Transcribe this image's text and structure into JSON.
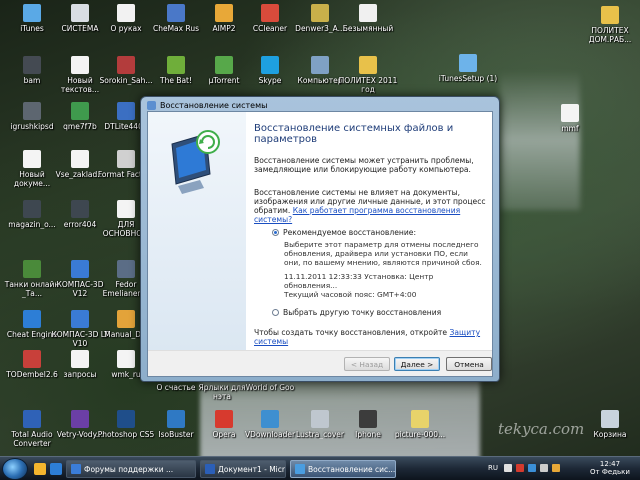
{
  "desktop": {
    "icons": [
      {
        "label": "iTunes",
        "color": "#5aa9e6",
        "col": 0,
        "row": 0
      },
      {
        "label": "СИСТЕМА",
        "color": "#d8dde3",
        "col": 1,
        "row": 0
      },
      {
        "label": "О руках",
        "color": "#f2f2f2",
        "col": 2,
        "row": 0
      },
      {
        "label": "CheMax Rus",
        "color": "#4a78c8",
        "col": 3,
        "row": 0
      },
      {
        "label": "AIMP2",
        "color": "#e8a838",
        "col": 4,
        "row": 0
      },
      {
        "label": "CCleaner",
        "color": "#d94b3b",
        "col": 5,
        "row": 0
      },
      {
        "label": "Denwer3_A...",
        "color": "#c9b04a",
        "col": 6,
        "row": 0
      },
      {
        "label": "Безымянный",
        "color": "#f0f0f0",
        "col": 7,
        "row": 0
      },
      {
        "label": "bam",
        "color": "#444a52",
        "col": 0,
        "row": 1
      },
      {
        "label": "Новый текстов...",
        "color": "#f4f4f4",
        "col": 1,
        "row": 1
      },
      {
        "label": "Sorokin_Sah...",
        "color": "#b33c3c",
        "col": 2,
        "row": 1
      },
      {
        "label": "The Bat!",
        "color": "#6fae3a",
        "col": 3,
        "row": 1
      },
      {
        "label": "µTorrent",
        "color": "#57a84a",
        "col": 4,
        "row": 1
      },
      {
        "label": "Skype",
        "color": "#1ea0e0",
        "col": 5,
        "row": 1
      },
      {
        "label": "Компьютер",
        "color": "#7fa1c4",
        "col": 6,
        "row": 1
      },
      {
        "label": "ПОЛИТЕХ 2011 год",
        "color": "#e8c14a",
        "col": 7,
        "row": 1
      },
      {
        "label": "igrushkipsd",
        "color": "#5d6670",
        "col": 0,
        "row": 2
      },
      {
        "label": "qme7f7b",
        "color": "#3f9a4d",
        "col": 1,
        "row": 2
      },
      {
        "label": "DTLite4402",
        "color": "#3b6fc2",
        "col": 2,
        "row": 2
      },
      {
        "label": "Новый докуме...",
        "color": "#f4f4f4",
        "col": 0,
        "row": 3
      },
      {
        "label": "Vse_zaklad...",
        "color": "#f4f4f4",
        "col": 1,
        "row": 3
      },
      {
        "label": "Format Factory",
        "color": "#d0d0d0",
        "col": 2,
        "row": 3
      },
      {
        "label": "magazin_o...",
        "color": "#3e4750",
        "col": 0,
        "row": 4
      },
      {
        "label": "error404",
        "color": "#3e4750",
        "col": 1,
        "row": 4
      },
      {
        "label": "ДЛЯ ОСНОВНО...",
        "color": "#f4f4f4",
        "col": 2,
        "row": 4
      },
      {
        "label": "Танки онлайн _Та...",
        "color": "#4a8a3a",
        "col": 0,
        "row": 5
      },
      {
        "label": "КОМПАС-3D V12",
        "color": "#3a7bd5",
        "col": 1,
        "row": 5
      },
      {
        "label": "Fedor Emelianen...",
        "color": "#5b6d86",
        "col": 2,
        "row": 5
      },
      {
        "label": "Cheat Engine",
        "color": "#2d7ed6",
        "col": 0,
        "row": 6
      },
      {
        "label": "КОМПАС-3D LT V10",
        "color": "#3a7bd5",
        "col": 1,
        "row": 6
      },
      {
        "label": "Manual_DIP",
        "color": "#e3a33a",
        "col": 2,
        "row": 6
      },
      {
        "label": "TODembel2.6",
        "color": "#c8403a",
        "col": 0,
        "row": 7
      },
      {
        "label": "запросы",
        "color": "#f4f4f4",
        "col": 1,
        "row": 7
      },
      {
        "label": "wmk_ru",
        "color": "#f4f4f4",
        "col": 2,
        "row": 7
      },
      {
        "label": "Total Audio Converter",
        "color": "#2f62b7",
        "col": 0,
        "row": 8
      },
      {
        "label": "Vetry-Vody...",
        "color": "#6b3fa6",
        "col": 1,
        "row": 8
      },
      {
        "label": "Photoshop CS5",
        "color": "#1f4e8a",
        "col": 2,
        "row": 8
      },
      {
        "label": "IsoBuster",
        "color": "#2f79c4",
        "col": 3,
        "row": 8
      },
      {
        "label": "Opera",
        "color": "#d73a2e",
        "col": 4,
        "row": 8
      },
      {
        "label": "VDownloader",
        "color": "#3e8fd0",
        "col": 5,
        "row": 8
      },
      {
        "label": "Lustra_cover",
        "color": "#bfc7cf",
        "col": 6,
        "row": 8
      },
      {
        "label": "Iphone",
        "color": "#3c3c3c",
        "col": 7,
        "row": 8
      },
      {
        "label": "picture-000...",
        "color": "#e8d36a",
        "col": 8,
        "row": 8
      }
    ],
    "right_icons": [
      {
        "label": "ПОЛИТЕХ ДОМ.РАБ...",
        "color": "#e8c14a"
      },
      {
        "label": "iTunesSetup (1)",
        "color": "#6db3ea"
      },
      {
        "label": "mmf",
        "color": "#f4f4f4"
      },
      {
        "label": "Корзина",
        "color": "#c8d3dd"
      }
    ],
    "bottom_labels": [
      "О счастье",
      "Ярлыки для нэта",
      "World of Goo"
    ],
    "watermark": "tekyca.com"
  },
  "dialog": {
    "title": "Восстановление системы",
    "heading": "Восстановление системных файлов и параметров",
    "para1": "Восстановление системы может устранить проблемы, замедляющие или блокирующие работу компьютера.",
    "para2_text": "Восстановление системы не влияет на документы, изображения или другие личные данные, и этот процесс обратим. ",
    "para2_link": "Как работает программа восстановления системы?",
    "option1_label": "Рекомендуемое восстановление:",
    "option1_desc": "Выберите этот параметр для отмены последнего обновления, драйвера или установки ПО, если они, по вашему мнению, являются причиной сбоя.",
    "restore_point": "11.11.2011 12:33:33 Установка: Центр обновления...",
    "timezone": "Текущий часовой пояс: GMT+4:00",
    "option2_label": "Выбрать другую точку восстановления",
    "protect_text": "Чтобы создать точку восстановления, откройте ",
    "protect_link": "Защиту системы",
    "back_button": "< Назад",
    "next_button": "Далее >",
    "cancel_button": "Отмена"
  },
  "taskbar": {
    "tasks": [
      {
        "label": "Форумы поддержки ...",
        "color": "#3b7dd8"
      },
      {
        "label": "Документ1 - Micros...",
        "color": "#2b5fb8"
      },
      {
        "label": "Восстановление сис...",
        "color": "#4a9de0"
      }
    ],
    "lang": "RU",
    "clock": "12:47\nОт Федьки"
  }
}
